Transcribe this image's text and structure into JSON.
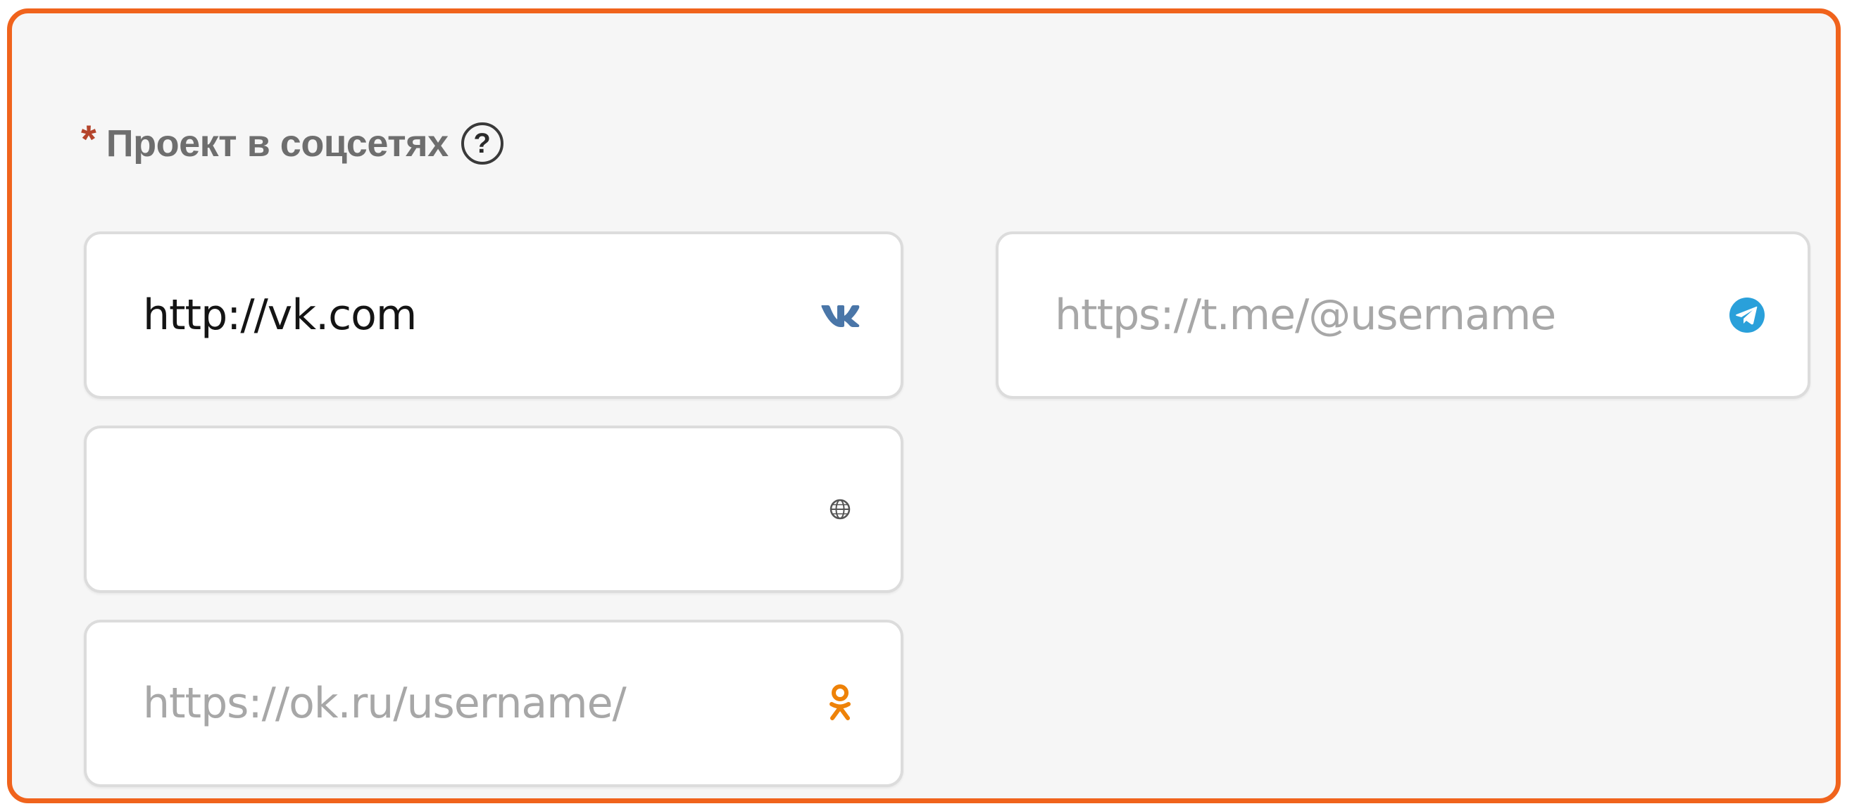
{
  "section": {
    "required_mark": "*",
    "title": "Проект в соцсетях",
    "help_symbol": "?"
  },
  "fields": {
    "vk": {
      "value": "http://vk.com",
      "placeholder": "",
      "icon": "vk-icon",
      "icon_color": "#4a76a8"
    },
    "telegram": {
      "value": "",
      "placeholder": "https://t.me/@username",
      "icon": "telegram-icon",
      "icon_color": "#2aa0da"
    },
    "website": {
      "value": "",
      "placeholder": "",
      "icon": "globe-icon",
      "icon_color": "#555555"
    },
    "ok": {
      "value": "",
      "placeholder": "https://ok.ru/username/",
      "icon": "odnoklassniki-icon",
      "icon_color": "#ee8208"
    }
  },
  "colors": {
    "accent_border": "#f0631c",
    "panel_bg": "#f6f6f6",
    "required_star": "#b5452c"
  }
}
